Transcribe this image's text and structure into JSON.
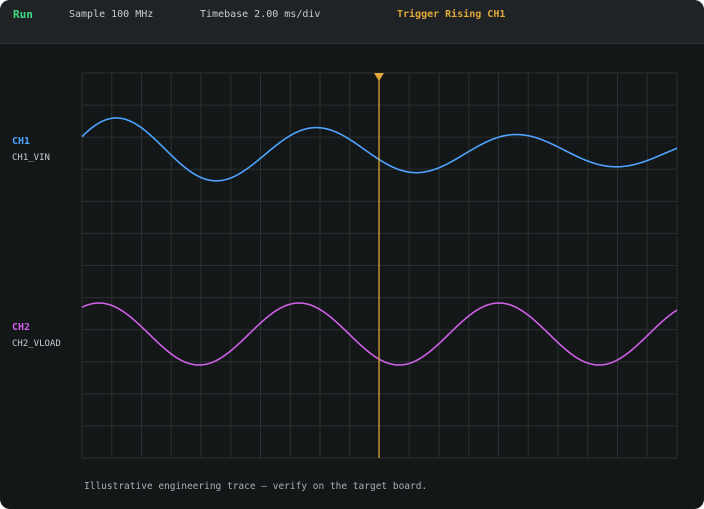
{
  "header": {
    "status": "Run",
    "sample": "Sample 100 MHz",
    "timebase": "Timebase 2.00 ms/div",
    "trigger": "Trigger Rising CH1"
  },
  "channels": [
    {
      "label": "CH1",
      "name": "CH1_VIN",
      "color": "#4da3ff"
    },
    {
      "label": "CH2",
      "name": "CH2_VLOAD",
      "color": "#d060e8"
    }
  ],
  "trigger_marker_color": "#e0a83a",
  "footnote": "Illustrative engineering trace — verify on the target board."
}
